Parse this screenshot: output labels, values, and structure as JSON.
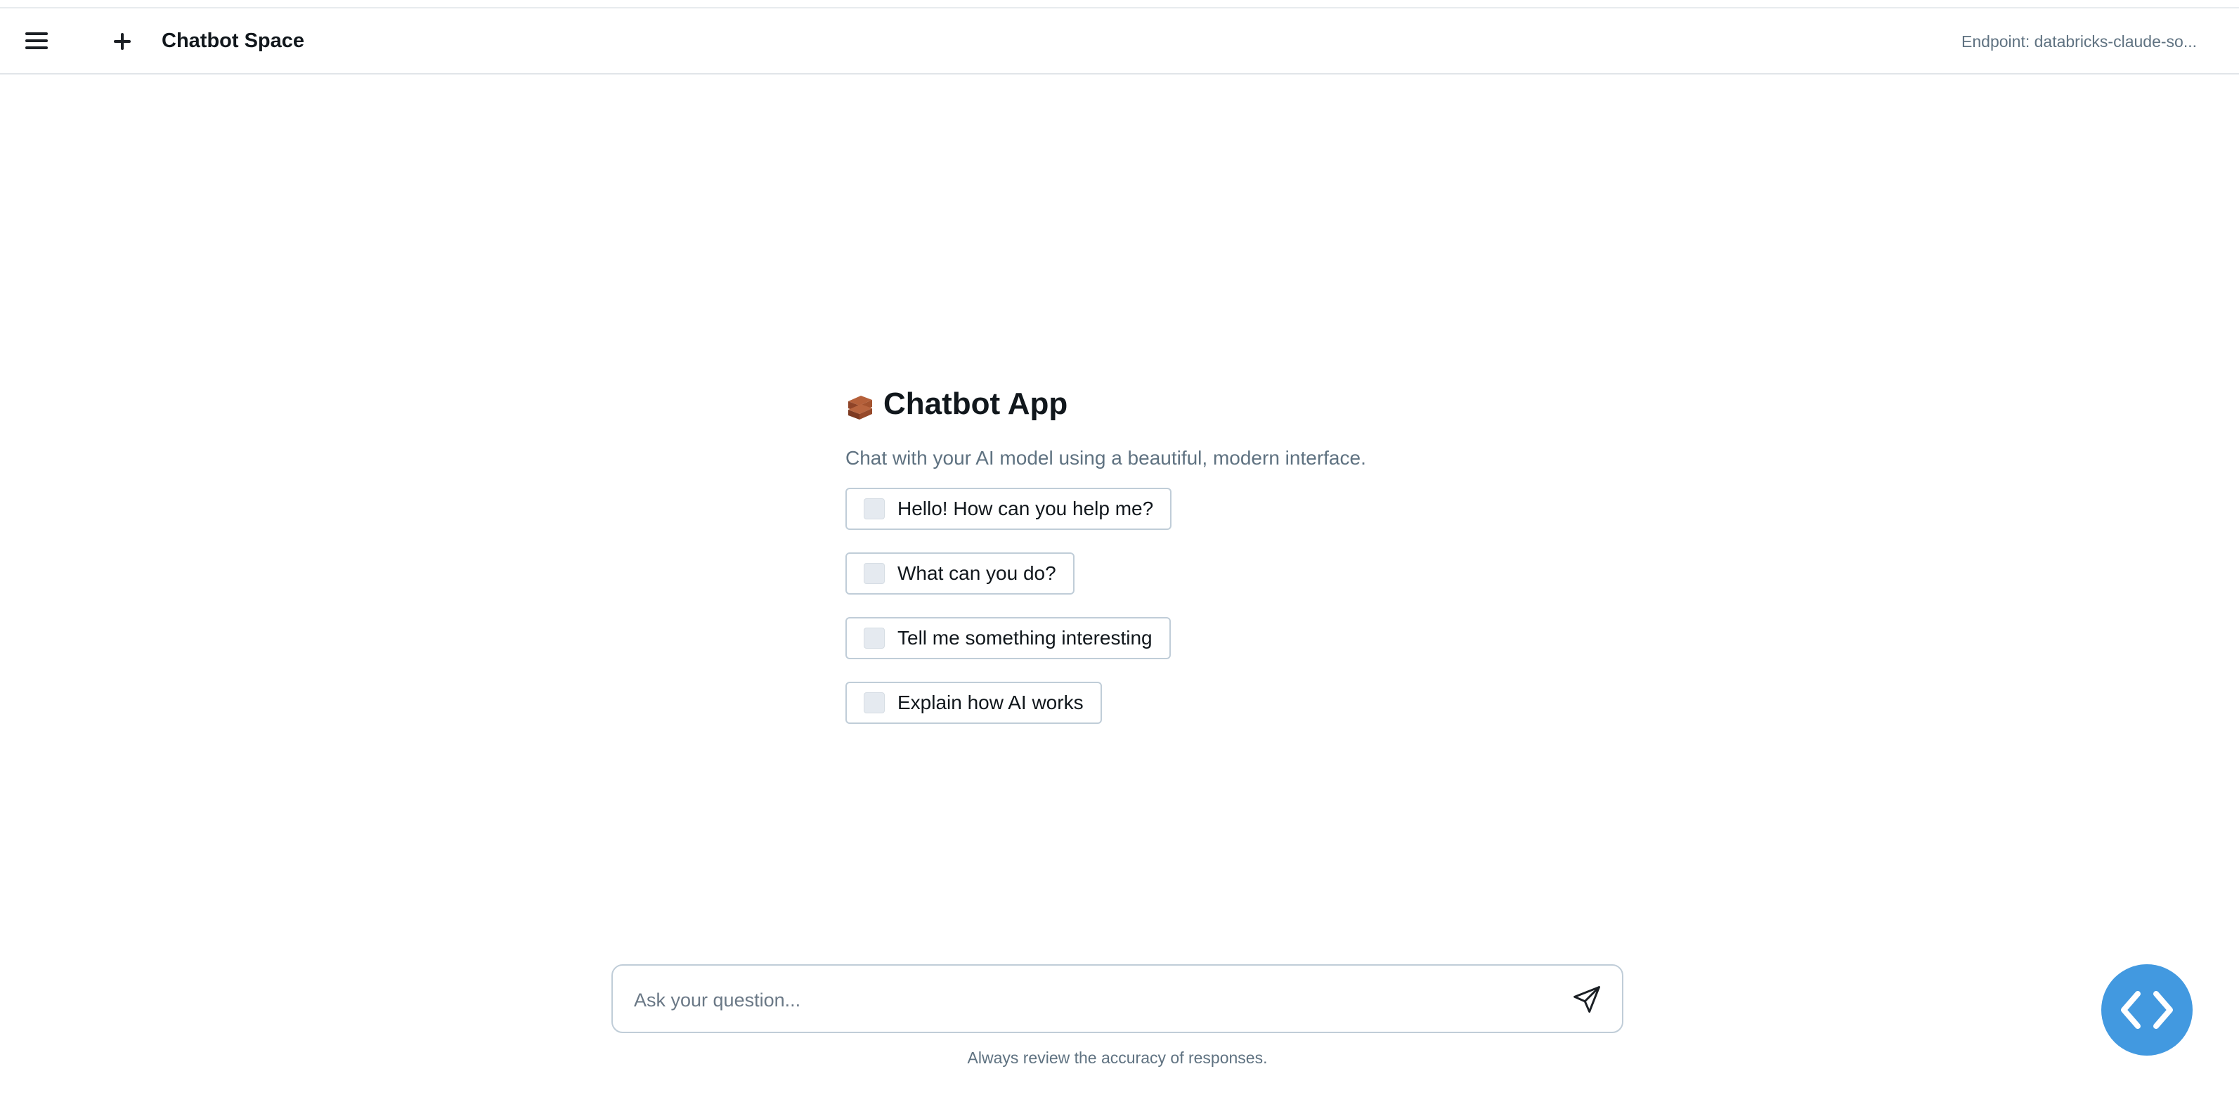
{
  "header": {
    "title": "Chatbot Space",
    "endpoint_label": "Endpoint: databricks-claude-so...",
    "menu_icon": "hamburger-menu-icon",
    "new_chat_icon": "plus-icon"
  },
  "welcome": {
    "title": "Chatbot App",
    "title_icon": "brick-emoji-icon",
    "subtitle": "Chat with your AI model using a beautiful, modern interface.",
    "suggestions": [
      {
        "label": "Hello! How can you help me?"
      },
      {
        "label": "What can you do?"
      },
      {
        "label": "Tell me something interesting"
      },
      {
        "label": "Explain how AI works"
      }
    ]
  },
  "composer": {
    "placeholder": "Ask your question...",
    "value": "",
    "send_icon": "send-paper-plane-icon"
  },
  "footer": {
    "disclaimer": "Always review the accuracy of responses."
  },
  "fab": {
    "icon": "code-brackets-icon"
  },
  "colors": {
    "accent": "#4299e0",
    "text_primary": "#11171c",
    "text_secondary": "#5f7281",
    "border": "#c0cdd8"
  }
}
